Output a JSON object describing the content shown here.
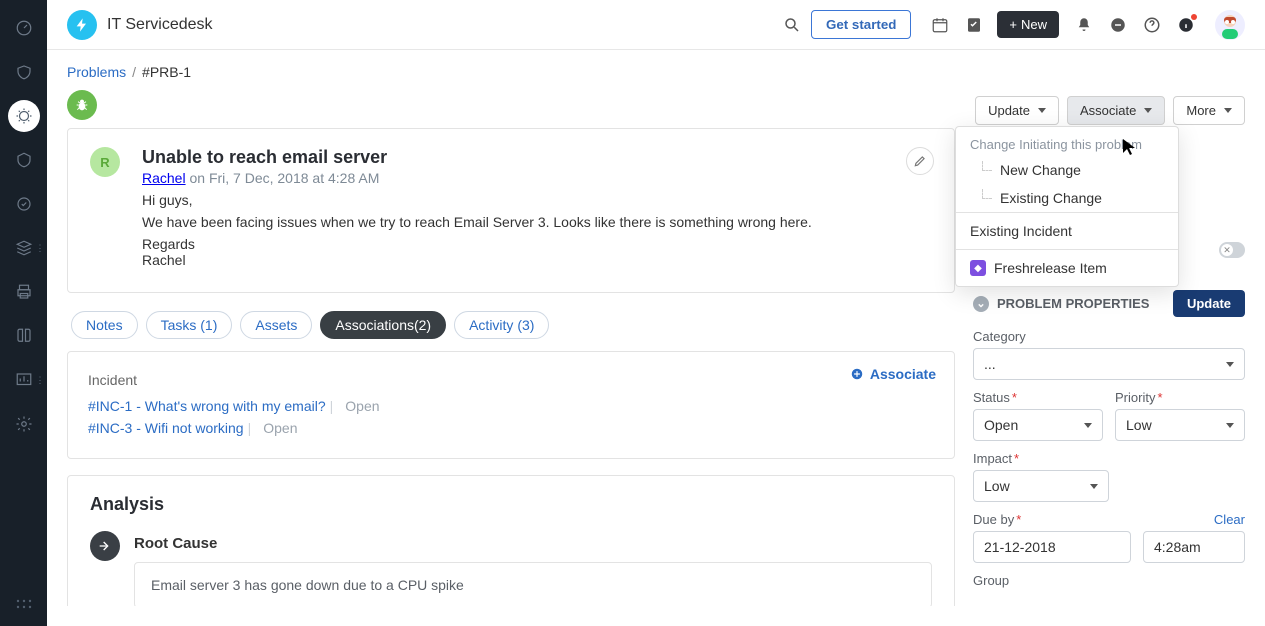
{
  "brand": "IT Servicedesk",
  "top": {
    "get_started": "Get started",
    "new": "New"
  },
  "breadcrumb": {
    "root": "Problems",
    "current": "#PRB-1"
  },
  "actions": {
    "update": "Update",
    "associate": "Associate",
    "more": "More"
  },
  "dropdown": {
    "section": "Change Initiating this problem",
    "new_change": "New Change",
    "existing_change": "Existing Change",
    "existing_incident": "Existing Incident",
    "freshrelease": "Freshrelease Item"
  },
  "ticket": {
    "requester_initial": "R",
    "title": "Unable to reach email server",
    "requester_name": "Rachel",
    "on": " on Fri, 7 Dec, 2018 at 4:28 AM",
    "body1": "Hi guys,",
    "body2": "We have been facing issues when we try to reach Email Server 3. Looks like there is something wrong here.",
    "body3": "Regards",
    "body4": "Rachel"
  },
  "tabs": {
    "notes": "Notes",
    "tasks": "Tasks (1)",
    "assets": "Assets",
    "assoc": "Associations(2)",
    "activity": "Activity (3)"
  },
  "assoc": {
    "associate": "Associate",
    "section": "Incident",
    "rows": [
      {
        "link": "#INC-1 - What's wrong with my email?",
        "status": "Open"
      },
      {
        "link": "#INC-3 - Wifi not working",
        "status": "Open"
      }
    ]
  },
  "analysis": {
    "title": "Analysis",
    "root_cause_label": "Root Cause",
    "root_cause_text": "Email server 3 has gone down due to a CPU spike"
  },
  "props": {
    "heading": "PROBLEM PROPERTIES",
    "update_btn": "Update",
    "category": {
      "label": "Category",
      "value": "..."
    },
    "status": {
      "label": "Status",
      "value": "Open"
    },
    "priority": {
      "label": "Priority",
      "value": "Low"
    },
    "impact": {
      "label": "Impact",
      "value": "Low"
    },
    "dueby_label": "Due by",
    "clear": "Clear",
    "due_date": "21-12-2018",
    "due_time": "4:28am",
    "group_label": "Group"
  }
}
